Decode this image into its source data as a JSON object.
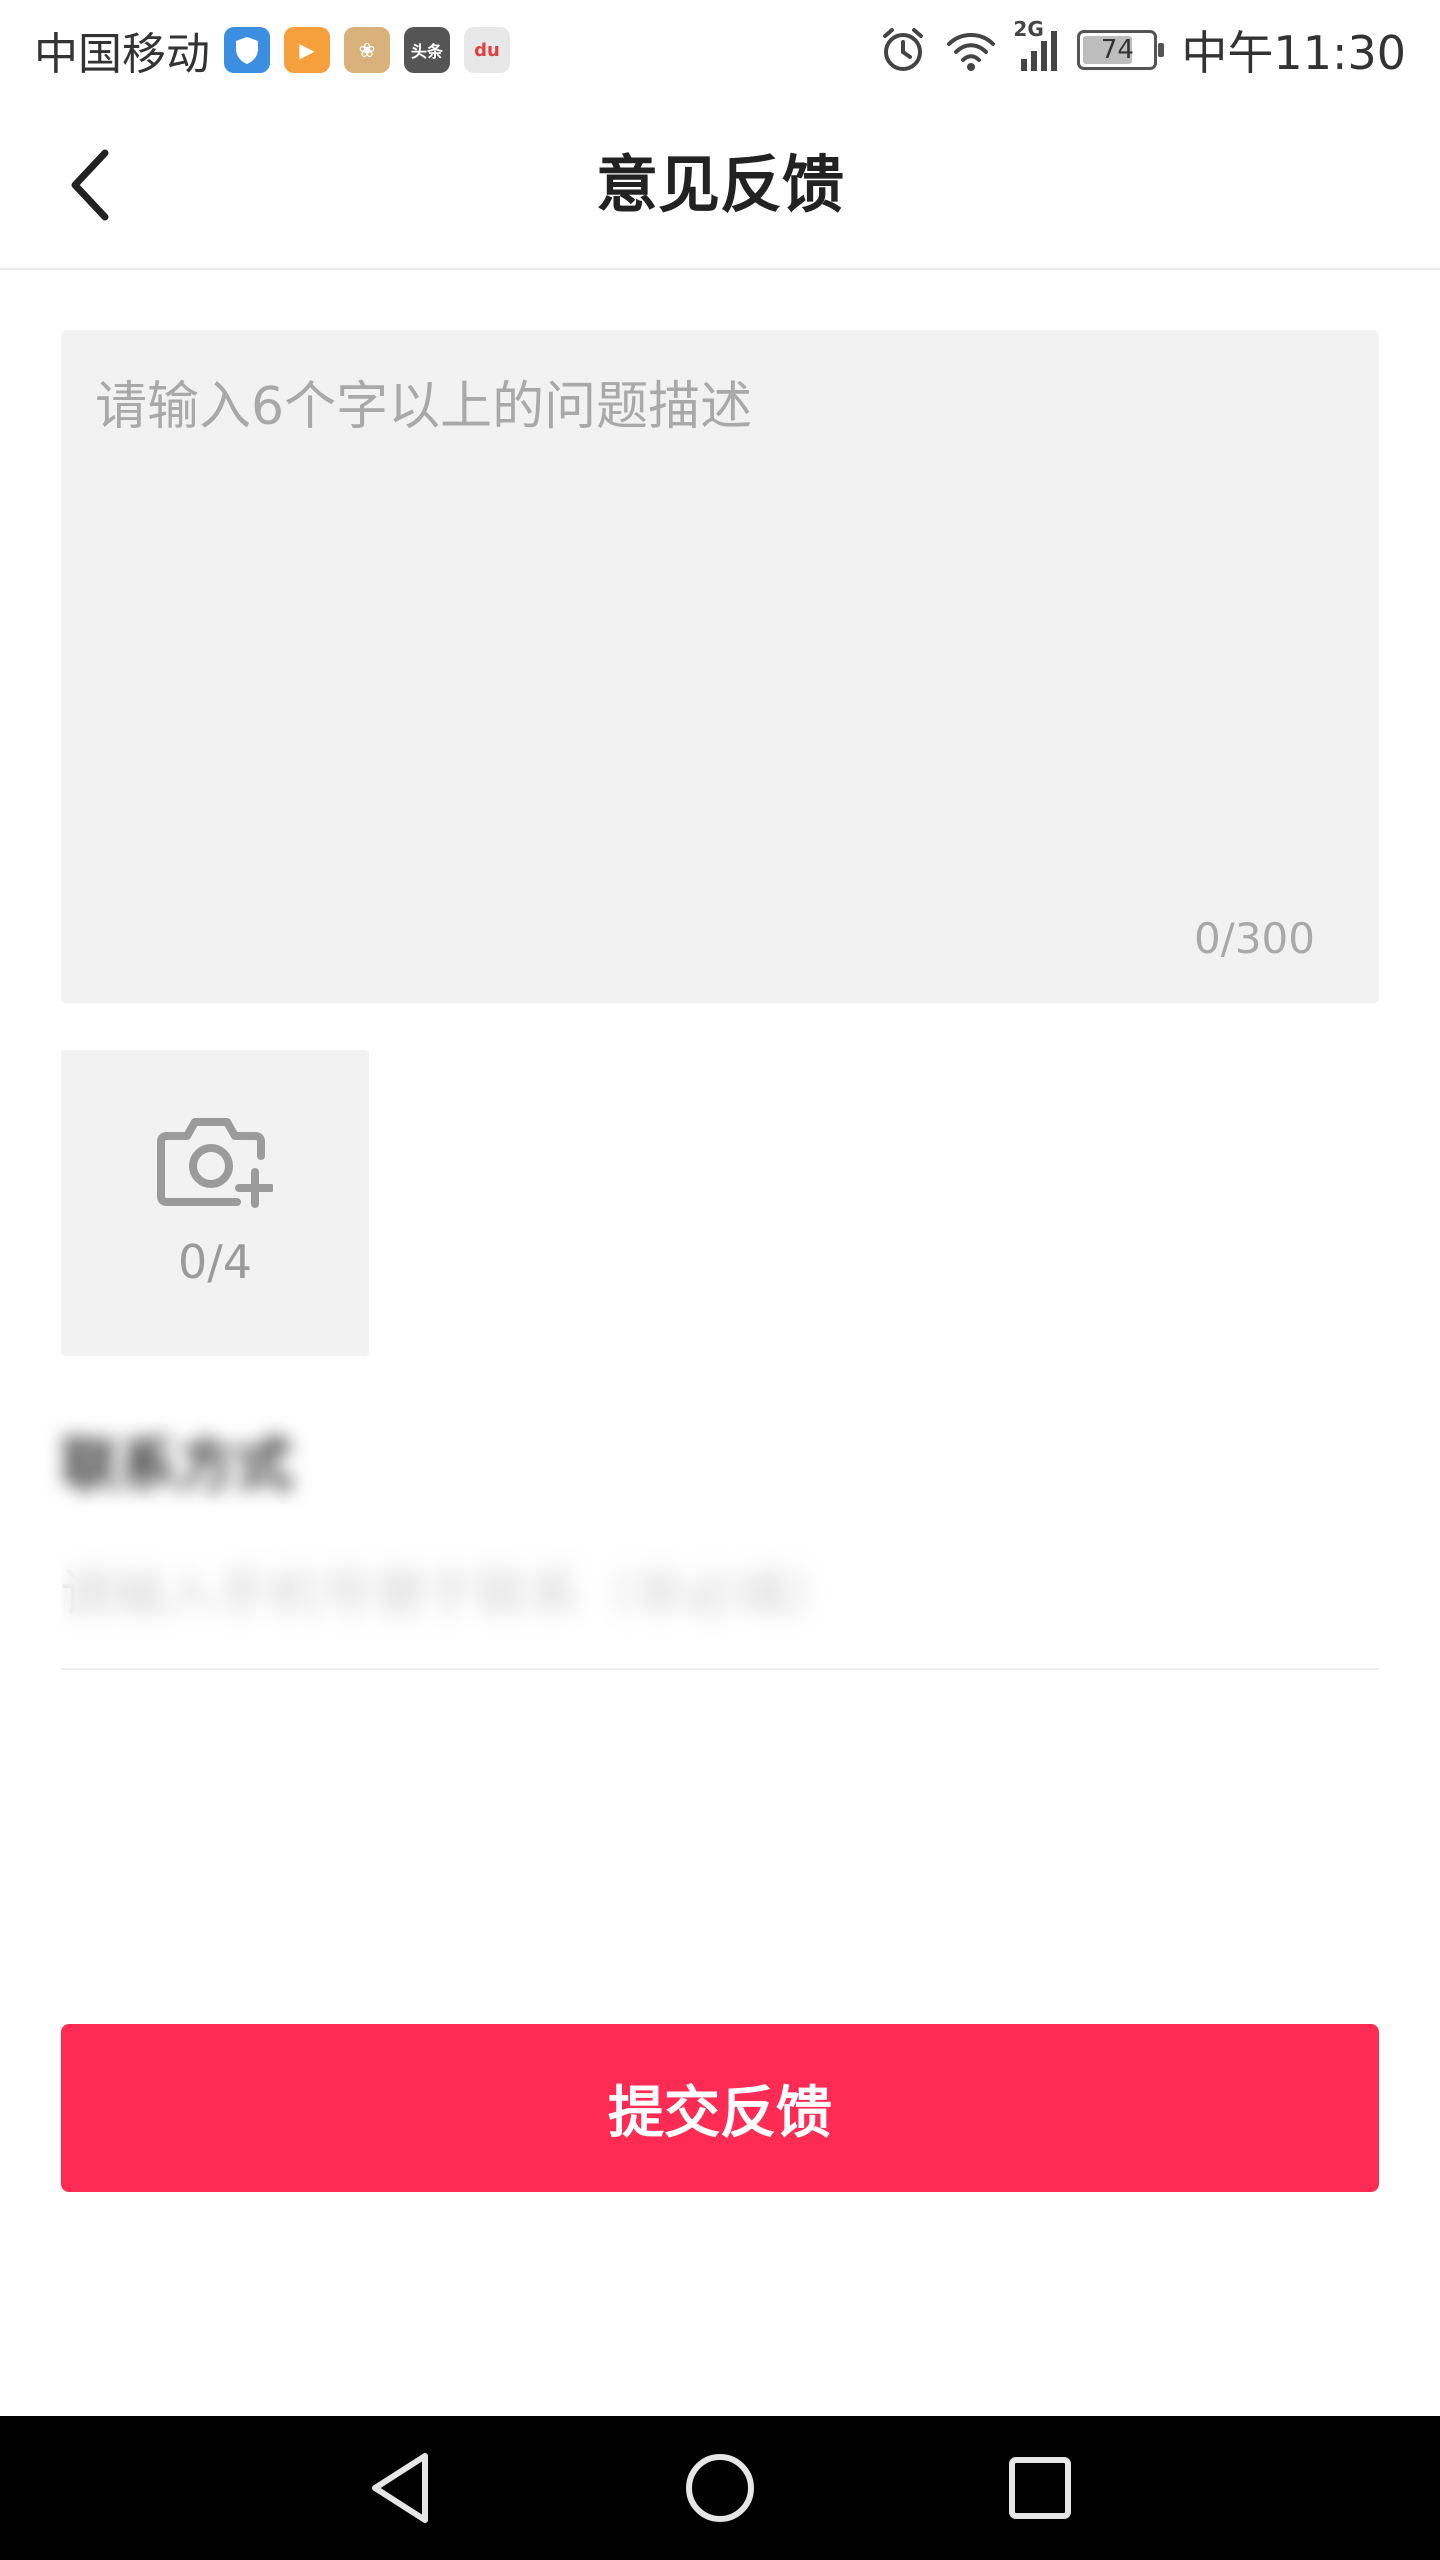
{
  "status_bar": {
    "carrier": "中国移动",
    "network": "2G",
    "battery": "74",
    "battery_level": 0.74,
    "time": "中午11:30",
    "app_icons": [
      {
        "name": "shield-app-icon",
        "color": "#3c8fe0",
        "label": ""
      },
      {
        "name": "video-app-icon",
        "color": "#f5a03c",
        "label": "▶"
      },
      {
        "name": "paw-app-icon",
        "color": "#d8b27a",
        "label": "❀"
      },
      {
        "name": "toutiao-app-icon",
        "color": "#555555",
        "label": "头条"
      },
      {
        "name": "map-app-icon",
        "color": "#e8e8e8",
        "label": "du"
      }
    ]
  },
  "header": {
    "title": "意见反馈",
    "back_icon": "chevron-left-icon"
  },
  "description": {
    "value": "",
    "placeholder": "请输入6个字以上的问题描述",
    "count": "0/300"
  },
  "upload": {
    "icon": "camera-plus-icon",
    "count": "0/4"
  },
  "contact": {
    "label": "联系方式",
    "placeholder": "请输入手机号便于联系（非必填）"
  },
  "submit": {
    "label": "提交反馈"
  },
  "colors": {
    "accent": "#fe2c55",
    "input_bg": "#f2f2f2",
    "placeholder": "#a9a9a9"
  },
  "nav": {
    "back_icon": "triangle-back-icon",
    "home_icon": "circle-home-icon",
    "recents_icon": "square-recents-icon"
  }
}
